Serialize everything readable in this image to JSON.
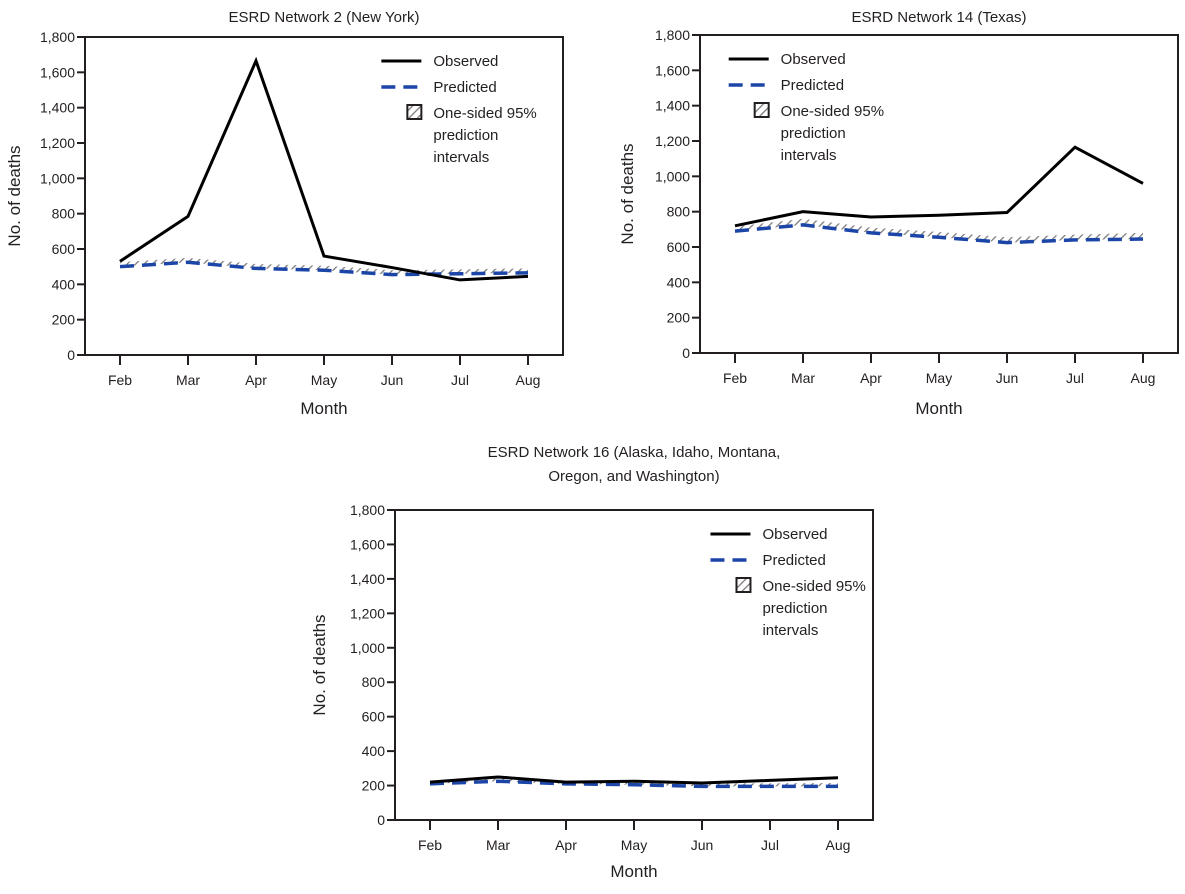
{
  "figure": {
    "colors": {
      "observed": "#000000",
      "predicted": "#1c45a8",
      "interval_hatch": "#777777",
      "axis": "#231f20"
    }
  },
  "chart_data": [
    {
      "type": "line",
      "title": "ESRD Network 2 (New York)",
      "title_lines": [
        "ESRD Network 2 (New York)"
      ],
      "xlabel": "Month",
      "ylabel": "No. of deaths",
      "categories": [
        "Feb",
        "Mar",
        "Apr",
        "May",
        "Jun",
        "Jul",
        "Aug"
      ],
      "ylim": [
        0,
        1800
      ],
      "yticks": [
        0,
        200,
        400,
        600,
        800,
        1000,
        1200,
        1400,
        1600,
        1800
      ],
      "ytick_labels": [
        "0",
        "200",
        "400",
        "600",
        "800",
        "1,000",
        "1,200",
        "1,400",
        "1,600",
        "1,800"
      ],
      "grid": false,
      "legend_placement": "top-right",
      "legend": [
        "Observed",
        "Predicted",
        "One-sided 95% prediction intervals"
      ],
      "legend_lines": [
        [
          "Observed"
        ],
        [
          "Predicted"
        ],
        [
          "One-sided 95%",
          "prediction",
          "intervals"
        ]
      ],
      "series": [
        {
          "name": "Observed",
          "values": [
            530,
            785,
            1665,
            560,
            495,
            425,
            445
          ]
        },
        {
          "name": "Predicted",
          "values": [
            500,
            525,
            490,
            480,
            455,
            460,
            465
          ]
        },
        {
          "name": "One-sided 95% prediction intervals",
          "values": [
            525,
            550,
            515,
            505,
            480,
            485,
            490
          ]
        }
      ]
    },
    {
      "type": "line",
      "title": "ESRD Network 14 (Texas)",
      "title_lines": [
        "ESRD Network 14 (Texas)"
      ],
      "xlabel": "Month",
      "ylabel": "No. of deaths",
      "categories": [
        "Feb",
        "Mar",
        "Apr",
        "May",
        "Jun",
        "Jul",
        "Aug"
      ],
      "ylim": [
        0,
        1800
      ],
      "yticks": [
        0,
        200,
        400,
        600,
        800,
        1000,
        1200,
        1400,
        1600,
        1800
      ],
      "ytick_labels": [
        "0",
        "200",
        "400",
        "600",
        "800",
        "1,000",
        "1,200",
        "1,400",
        "1,600",
        "1,800"
      ],
      "grid": false,
      "legend_placement": "top-left",
      "legend": [
        "Observed",
        "Predicted",
        "One-sided 95% prediction intervals"
      ],
      "legend_lines": [
        [
          "Observed"
        ],
        [
          "Predicted"
        ],
        [
          "One-sided 95%",
          "prediction",
          "intervals"
        ]
      ],
      "series": [
        {
          "name": "Observed",
          "values": [
            720,
            800,
            770,
            780,
            795,
            1165,
            960
          ]
        },
        {
          "name": "Predicted",
          "values": [
            690,
            725,
            680,
            655,
            625,
            640,
            645
          ]
        },
        {
          "name": "One-sided 95% prediction intervals",
          "values": [
            715,
            760,
            710,
            685,
            655,
            670,
            680
          ]
        }
      ]
    },
    {
      "type": "line",
      "title": "ESRD Network 16 (Alaska, Idaho, Montana, Oregon, and Washington)",
      "title_lines": [
        "ESRD Network 16 (Alaska, Idaho, Montana,",
        "Oregon, and Washington)"
      ],
      "xlabel": "Month",
      "ylabel": "No. of deaths",
      "categories": [
        "Feb",
        "Mar",
        "Apr",
        "May",
        "Jun",
        "Jul",
        "Aug"
      ],
      "ylim": [
        0,
        1800
      ],
      "yticks": [
        0,
        200,
        400,
        600,
        800,
        1000,
        1200,
        1400,
        1600,
        1800
      ],
      "ytick_labels": [
        "0",
        "200",
        "400",
        "600",
        "800",
        "1,000",
        "1,200",
        "1,400",
        "1,600",
        "1,800"
      ],
      "grid": false,
      "legend_placement": "top-right",
      "legend": [
        "Observed",
        "Predicted",
        "One-sided 95% prediction intervals"
      ],
      "legend_lines": [
        [
          "Observed"
        ],
        [
          "Predicted"
        ],
        [
          "One-sided 95%",
          "prediction",
          "intervals"
        ]
      ],
      "series": [
        {
          "name": "Observed",
          "values": [
            220,
            250,
            220,
            225,
            215,
            230,
            245
          ]
        },
        {
          "name": "Predicted",
          "values": [
            210,
            225,
            210,
            205,
            195,
            195,
            195
          ]
        },
        {
          "name": "One-sided 95% prediction intervals",
          "values": [
            228,
            243,
            228,
            223,
            213,
            213,
            215
          ]
        }
      ]
    }
  ]
}
